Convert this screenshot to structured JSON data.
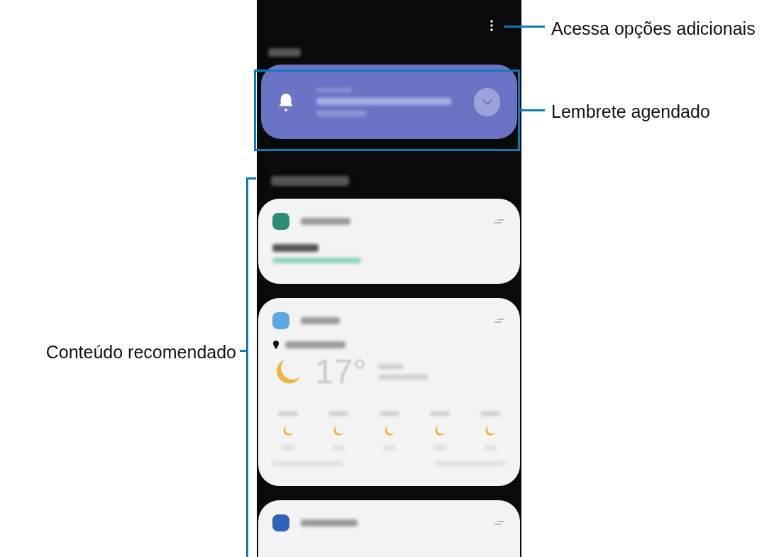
{
  "callouts": [
    {
      "text": "Acessa opções adicionais"
    },
    {
      "text": "Lembrete agendado"
    },
    {
      "text": "Conteúdo recomendado"
    }
  ],
  "weather": {
    "temperature": "17°"
  }
}
